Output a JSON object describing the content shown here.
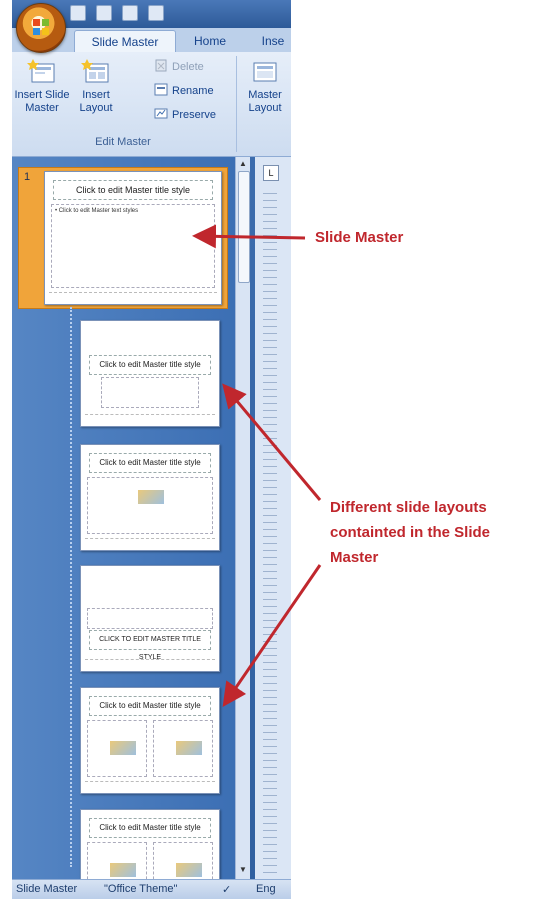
{
  "ribbon": {
    "tabs": [
      "Slide Master",
      "Home",
      "Inse"
    ],
    "buttons": {
      "insert_slide_master": "Insert Slide\nMaster",
      "insert_layout": "Insert\nLayout",
      "delete": "Delete",
      "rename": "Rename",
      "preserve": "Preserve",
      "master_layout": "Master\nLayout"
    },
    "group_label": "Edit Master"
  },
  "thumbnails": {
    "selected_number": "1",
    "master_title": "Click to edit Master title style",
    "master_body": "• Click to edit Master text styles",
    "layout_title": "Click to edit Master title style",
    "title_only_caps": "CLICK TO EDIT MASTER TITLE STYLE"
  },
  "status_bar": {
    "mode": "Slide Master",
    "theme": "\"Office Theme\"",
    "language": "Eng"
  },
  "annotations": {
    "slide_master": "Slide Master",
    "layouts": [
      "Different slide layouts",
      "containted in the Slide",
      "Master"
    ],
    "color": "#c0272d"
  }
}
